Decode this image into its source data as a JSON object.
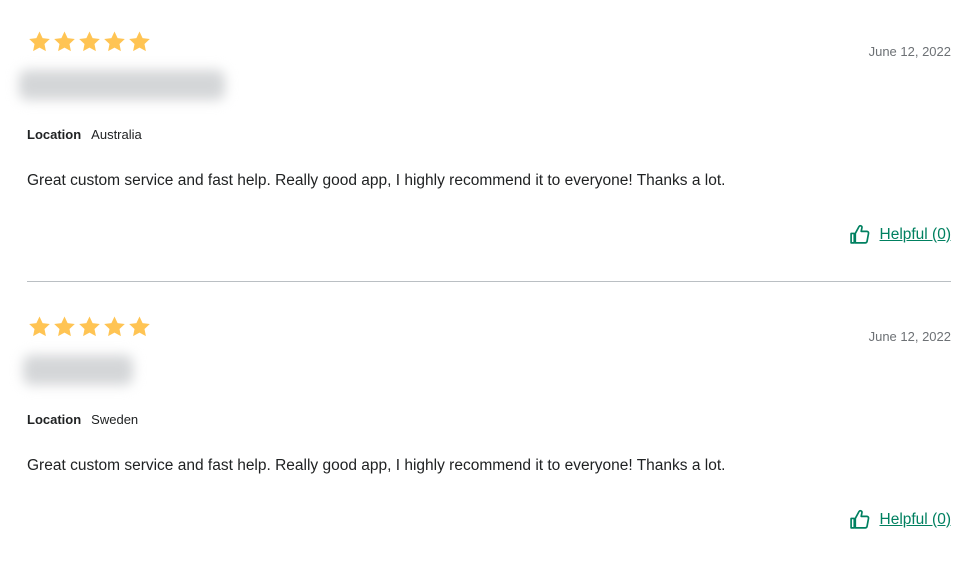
{
  "colors": {
    "star": "#ffc453",
    "accent": "#008060",
    "text": "#202223",
    "muted": "#6d7175",
    "divider": "#babfc3"
  },
  "reviews": [
    {
      "rating": 5,
      "date": "June 12, 2022",
      "location_label": "Location",
      "location": "Australia",
      "body": "Great custom service and fast help. Really good app, I highly recommend it to everyone! Thanks a lot.",
      "helpful_label": "Helpful (0)",
      "helpful_icon": "thumbs-up-icon"
    },
    {
      "rating": 5,
      "date": "June 12, 2022",
      "location_label": "Location",
      "location": "Sweden",
      "body": "Great custom service and fast help. Really good app, I highly recommend it to everyone! Thanks a lot.",
      "helpful_label": "Helpful (0)",
      "helpful_icon": "thumbs-up-icon"
    }
  ]
}
